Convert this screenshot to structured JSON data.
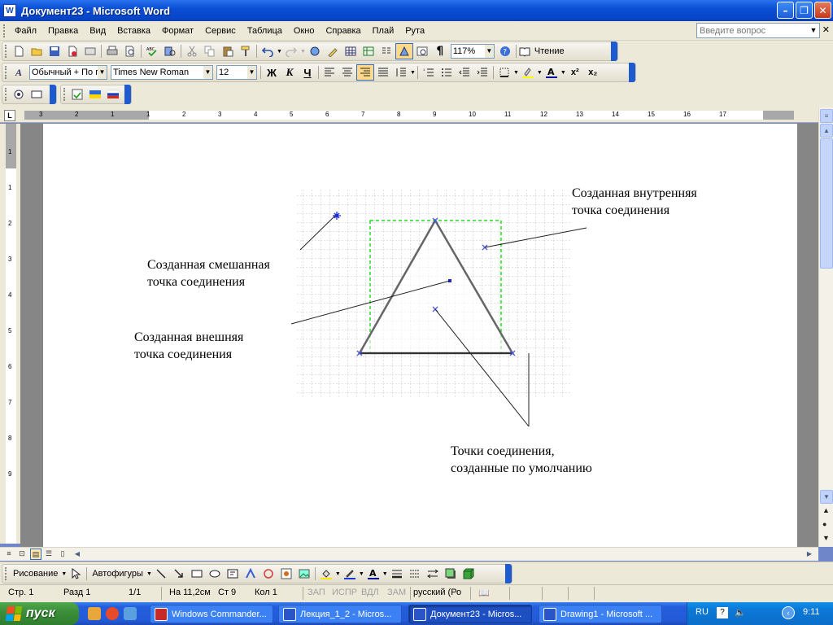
{
  "window": {
    "title": "Документ23 - Microsoft Word",
    "icon_letter": "W"
  },
  "menu": {
    "items": [
      "Файл",
      "Правка",
      "Вид",
      "Вставка",
      "Формат",
      "Сервис",
      "Таблица",
      "Окно",
      "Справка",
      "Плай",
      "Рута"
    ],
    "help_placeholder": "Введите вопрос"
  },
  "standard_toolbar": {
    "zoom": "117%",
    "read_label": "Чтение"
  },
  "formatting_toolbar": {
    "style": "Обычный + По г",
    "font": "Times New Roman",
    "size": "12",
    "bold": "Ж",
    "italic": "К",
    "underline": "Ч"
  },
  "ruler": {
    "h_numbers": [
      "3",
      "2",
      "1",
      "1",
      "2",
      "3",
      "4",
      "5",
      "6",
      "7",
      "8",
      "9",
      "10",
      "11",
      "12",
      "13",
      "14",
      "15",
      "16",
      "17"
    ],
    "v_numbers": [
      "1",
      "1",
      "2",
      "3",
      "4",
      "5",
      "6",
      "7",
      "8",
      "9"
    ]
  },
  "diagram": {
    "labels": {
      "inner": [
        "Созданная внутренняя",
        "точка соединения"
      ],
      "mixed": [
        "Созданная смешанная",
        "точка соединения"
      ],
      "outer": [
        "Созданная внешняя",
        "точка соединения"
      ],
      "default": [
        "Точки соединения,",
        "созданные по умолчанию"
      ]
    }
  },
  "drawing_toolbar": {
    "drawing": "Рисование",
    "autoshapes": "Автофигуры"
  },
  "status": {
    "page": "Стр. 1",
    "section": "Разд 1",
    "pages": "1/1",
    "at": "На 11,2см",
    "line": "Ст 9",
    "col": "Кол 1",
    "rec": "ЗАП",
    "trk": "ИСПР",
    "ext": "ВДЛ",
    "ovr": "ЗАМ",
    "lang": "русский (Ро"
  },
  "taskbar": {
    "start": "пуск",
    "tasks": [
      "Windows Commander...",
      "Лекция_1_2 - Micros...",
      "Документ23 - Micros...",
      "Drawing1 - Microsoft ..."
    ],
    "lang": "RU",
    "clock": "9:11"
  }
}
